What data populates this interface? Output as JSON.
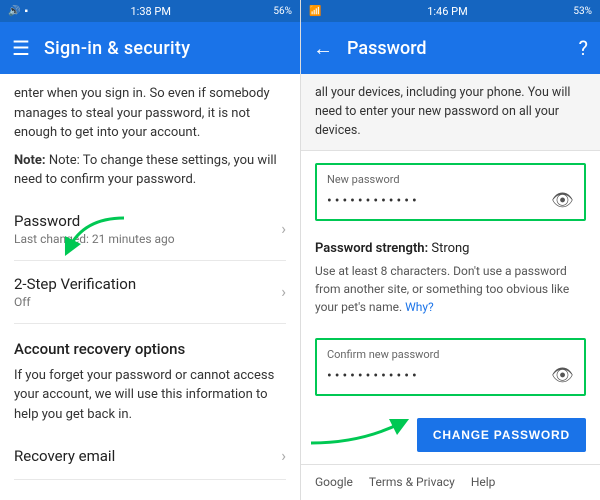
{
  "left": {
    "statusBar": {
      "time": "1:38 PM",
      "battery": "56%",
      "signal": "2"
    },
    "header": {
      "title": "Sign-in & security",
      "menuIcon": "☰"
    },
    "bodyText": "enter when you sign in. So even if somebody manages to steal your password, it is not enough to get into your account.",
    "noteText": "Note: To change these settings, you will need to confirm your password.",
    "menuItems": [
      {
        "title": "Password",
        "subtitle": "Last changed: 21 minutes ago"
      },
      {
        "title": "2-Step Verification",
        "subtitle": "Off"
      }
    ],
    "sectionHeader": "Account recovery options",
    "sectionDesc": "If you forget your password or cannot access your account, we will use this information to help you get back in.",
    "recoveryLabel": "Recovery email",
    "chevron": "›"
  },
  "right": {
    "statusBar": {
      "time": "1:46 PM",
      "battery": "53%",
      "signal": "2"
    },
    "header": {
      "title": "Password",
      "backArrow": "←",
      "helpIcon": "?"
    },
    "infoText": "all your devices, including your phone. You will need to enter your new password on all your devices.",
    "newPasswordLabel": "New password",
    "newPasswordValue": "••••••••••••",
    "eyeIcon": "👁",
    "strengthLabel": "Password strength:",
    "strengthValue": "Strong",
    "strengthDesc": "Use at least 8 characters. Don't use a password from another site, or something too obvious like your pet's name.",
    "whyLink": "Why?",
    "confirmPasswordLabel": "Confirm new password",
    "confirmPasswordValue": "••••••••••••",
    "changePasswordBtn": "CHANGE PASSWORD",
    "footer": {
      "google": "Google",
      "terms": "Terms & Privacy",
      "help": "Help"
    }
  }
}
